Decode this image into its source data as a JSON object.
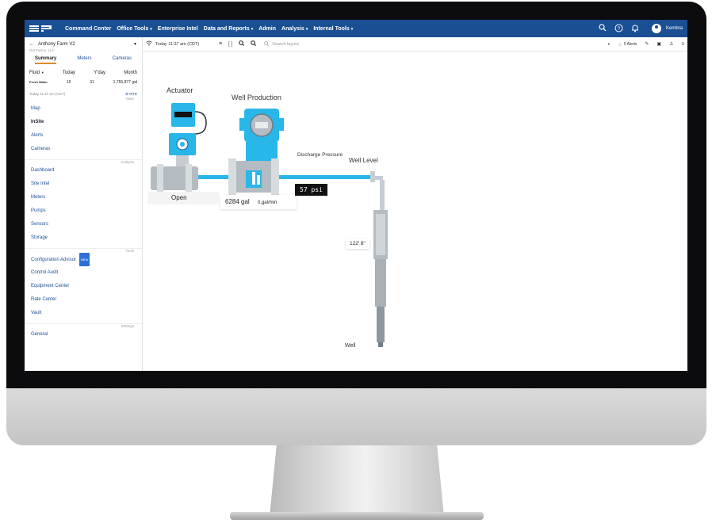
{
  "nav": {
    "items": [
      {
        "label": "Command Center",
        "caret": false
      },
      {
        "label": "Office Tools",
        "caret": true
      },
      {
        "label": "Enterprise Intel",
        "caret": false
      },
      {
        "label": "Data and Reports",
        "caret": true
      },
      {
        "label": "Admin",
        "caret": false
      },
      {
        "label": "Analysis",
        "caret": true
      },
      {
        "label": "Internal Tools",
        "caret": true
      }
    ],
    "notification_count": "",
    "user_name": "Kembra"
  },
  "sidebar": {
    "farm_name": "Anthony Farm V2",
    "company": "GO Farms, LLC",
    "tabs": [
      "Summary",
      "Meters",
      "Cameras"
    ],
    "fluid": {
      "label": "Fluid",
      "cols": [
        "Today",
        "Y'day",
        "Month"
      ]
    },
    "fresh_water": {
      "label": "Fresh Water",
      "today": "15",
      "yday": "31",
      "month": "1,755,877",
      "unit": "gal"
    },
    "timestamp": "Today 11:37 am (CDT)",
    "mtr_label": "MTR",
    "main_label": "Main",
    "main_links": [
      "Map",
      "InSite",
      "Alerts",
      "Cameras"
    ],
    "analysis_label": "Analysis",
    "analysis_links": [
      "Dashboard",
      "Site Intel",
      "Meters",
      "Pumps",
      "Sensors",
      "Storage"
    ],
    "tools_label": "Tools",
    "tools_links": [
      "Configuration Advisor",
      "Control Audit",
      "Equipment Center",
      "Rate Center",
      "Vault"
    ],
    "new_badge": "NEW",
    "settings_label": "Settings",
    "settings_links": [
      "General"
    ]
  },
  "toolbar": {
    "time": "Today 11:37 am (CDT)",
    "search_placeholder": "Search layout",
    "alerts": "0 Alerts"
  },
  "diagram": {
    "actuator_label": "Actuator",
    "well_production_label": "Well Production",
    "discharge_pressure_label": "Discharge Pressure",
    "well_level_label": "Well Level",
    "valve_state": "Open",
    "total_volume": "6284 gal",
    "flow_rate": "0,gal/min",
    "pressure": "57 psi",
    "level_reading": "122' 8\"",
    "well_label": "Well"
  },
  "colors": {
    "brand": "#1a4f93",
    "pipe": "#29b6e8",
    "accent": "#e08a2c"
  }
}
